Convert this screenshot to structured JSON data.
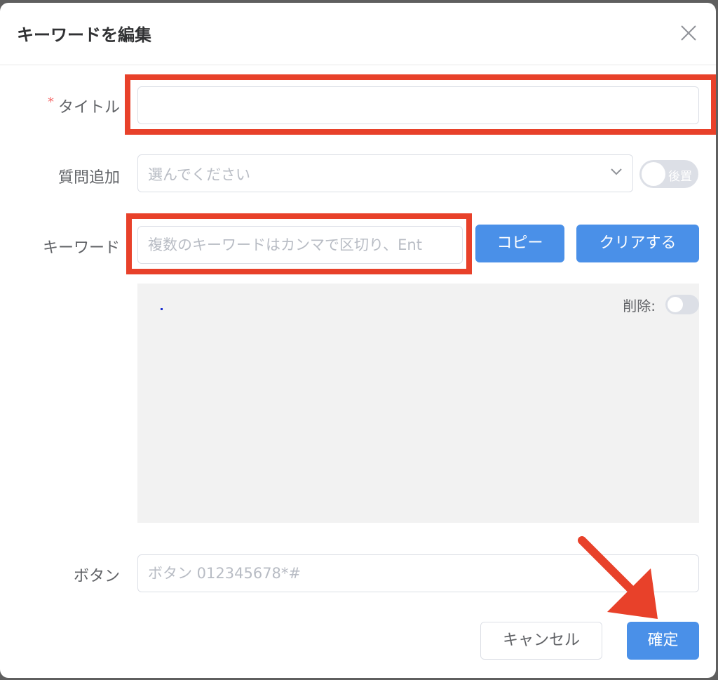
{
  "dialog": {
    "title": "キーワードを編集"
  },
  "form": {
    "title_field": {
      "required_mark": "*",
      "label": "タイトル",
      "value": "",
      "placeholder": ""
    },
    "question_field": {
      "label": "質問追加",
      "placeholder": "選んでください",
      "switch_text": "後置"
    },
    "keyword_field": {
      "label": "キーワード",
      "placeholder": "複数のキーワードはカンマで区切り、Ent",
      "copy_button": "コピー",
      "clear_button": "クリアする",
      "delete_label": "削除:"
    },
    "button_field": {
      "label": "ボタン",
      "placeholder": "ボタン 012345678*#"
    }
  },
  "footer": {
    "cancel_button": "キャンセル",
    "confirm_button": "確定"
  },
  "colors": {
    "primary": "#4a90e8",
    "annotation": "#e8412a",
    "required": "#f56c6c"
  },
  "icons": {
    "close": "close-icon",
    "chevron": "chevron-down-icon",
    "arrow": "annotation-arrow-icon"
  }
}
